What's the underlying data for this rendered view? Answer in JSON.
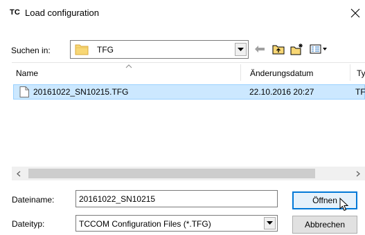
{
  "window": {
    "app_logo": "TC",
    "title": "Load configuration",
    "close_icon": "close-icon"
  },
  "lookin": {
    "label": "Suchen in:",
    "folder_name": "TFG",
    "folder_icon": "folder-icon",
    "toolbar_icons": [
      "back-arrow-icon",
      "up-folder-icon",
      "new-folder-icon",
      "view-menu-icon"
    ]
  },
  "filelist": {
    "columns": [
      "Name",
      "Änderungsdatum",
      "Ty"
    ],
    "rows": [
      {
        "name": "20161022_SN10215.TFG",
        "date": "22.10.2016 20:27",
        "type": "TF",
        "selected": true
      }
    ]
  },
  "fields": {
    "filename_label": "Dateiname:",
    "filename_value": "20161022_SN10215",
    "filetype_label": "Dateityp:",
    "filetype_value": "TCCOM Configuration Files (*.TFG)"
  },
  "buttons": {
    "open": "Öffnen",
    "cancel": "Abbrechen"
  },
  "colors": {
    "selection_bg": "#cce8ff",
    "selection_border": "#99d1ff",
    "default_button_border": "#0078d7",
    "folder_yellow": "#f8d775"
  }
}
